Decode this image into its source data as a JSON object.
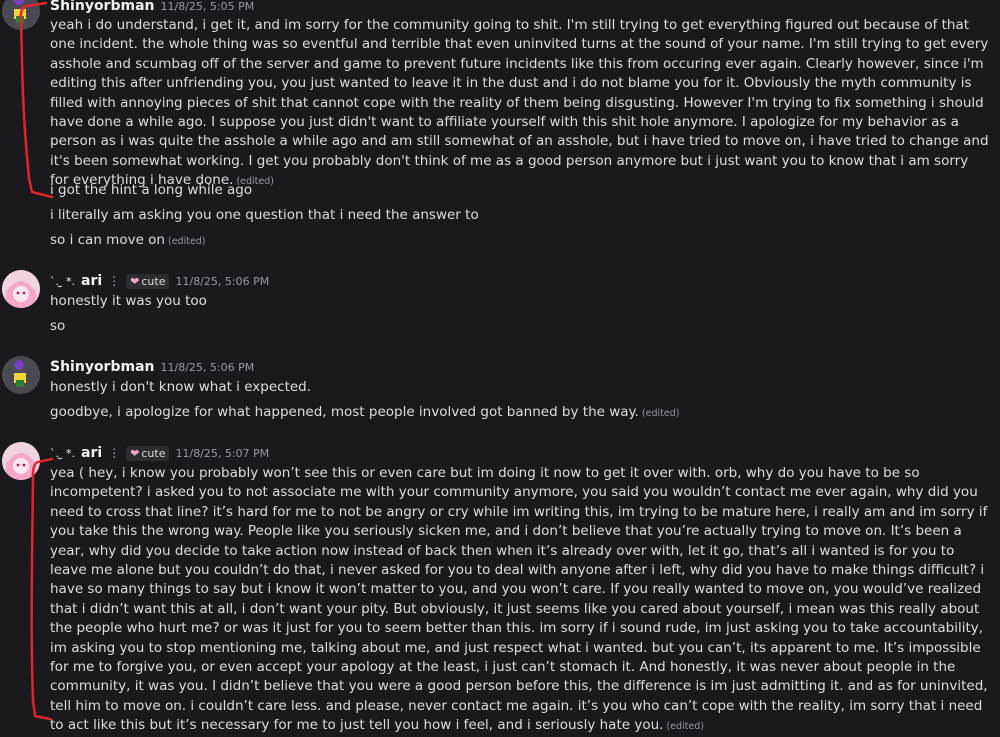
{
  "messages": [
    {
      "author": "Shinyorbman",
      "timestamp": "11/8/25, 5:05 PM",
      "lines": [
        {
          "text": "yeah i do understand, i get it, and im sorry for the community going to shit. I'm still trying to get everything figured out because of that one incident. the whole thing was so eventful and terrible that even uninvited turns at the sound of your name. I'm still trying to get every asshole and scumbag off of the server and game to prevent future incidents like this from occuring ever again. Clearly however, since i'm editing this after unfriending you, you just wanted to leave it in the dust and i do not blame you for it. Obviously the myth community is filled with annoying pieces of shit that cannot cope with the reality of them being disgusting. However I'm trying to fix something i should have done a while ago. I suppose you just didn't want to affiliate yourself with this shit hole anymore. I apologize for my behavior as a person as i was quite the asshole a while ago and am still somewhat of an asshole, but i have tried to move on, i have tried to change and it's been somewhat working. I get you probably don't think of me as a good person anymore but i just want you to know that i am sorry for everything i have done.",
          "edited": "(edited)"
        },
        {
          "text": "i got the hint a long while ago",
          "edited": ""
        },
        {
          "text": "i literally am asking you one question that i need the answer to",
          "edited": ""
        },
        {
          "text": "so i can move on",
          "edited": "(edited)"
        }
      ]
    },
    {
      "author": "ari",
      "author_prefix": "`. ̫ *.",
      "role_tag": "cute",
      "timestamp": "11/8/25, 5:06 PM",
      "lines": [
        {
          "text": "honestly it was you too",
          "edited": ""
        },
        {
          "text": "so",
          "edited": ""
        }
      ]
    },
    {
      "author": "Shinyorbman",
      "timestamp": "11/8/25, 5:06 PM",
      "lines": [
        {
          "text": "honestly i don't know what i expected.",
          "edited": ""
        },
        {
          "text": "goodbye, i apologize for what happened, most people involved got banned by the way.",
          "edited": "(edited)"
        }
      ]
    },
    {
      "author": "ari",
      "author_prefix": "`. ̫ *.",
      "role_tag": "cute",
      "timestamp": "11/8/25, 5:07 PM",
      "lines": [
        {
          "text": "yea ( hey, i know you probably won’t see this or even care but im doing it now to get it over with. orb, why do you have to be so incompetent? i asked you to not associate me with your community anymore, you said you wouldn’t contact me ever again, why did you need to cross that line? it’s hard for me to not be angry or cry while im writing this, im trying to be mature here, i really am and im sorry if you take this the wrong way. People like you seriously sicken me, and i don’t believe that you’re actually trying to move on. It’s been a year, why did you decide to take action now instead of back then when it’s already over with, let it go, that’s all i wanted is for you to leave me alone but you couldn’t do that, i never asked for you to deal with anyone after i left, why did you have to make things difficult? i have so many things to say but i know it won’t matter to you, and you won’t care. If you really wanted to move on, you would’ve realized that i didn’t want this at all, i don’t want your pity. But obviously, it just seems like you cared about yourself, i mean was this really about the people who hurt me? or was it just for you to seem better than this. im sorry if i sound rude, im just asking you to take accountability, im asking you to stop mentioning me, talking about me, and just respect what i wanted. but you can’t, its apparent to me. It’s impossible for me to forgive you, or even accept your apology at the least, i just can’t stomach it. And honestly, it was never about people in the community, it was you. I didn’t  believe that you were a good person before this, the difference is im just admitting it. and as for uninvited, tell him to move on. i couldn’t care less. and please, never contact me again. it’s you who can’t cope with the reality, im sorry that i need to act like this but it’s necessary for me to just tell you how i feel, and i seriously hate you.",
          "edited": "(edited)"
        }
      ]
    }
  ],
  "colors": {
    "background": "#1a1a1e",
    "text": "#dbdee1",
    "muted": "#949ba4",
    "annotation": "#e0242b"
  }
}
